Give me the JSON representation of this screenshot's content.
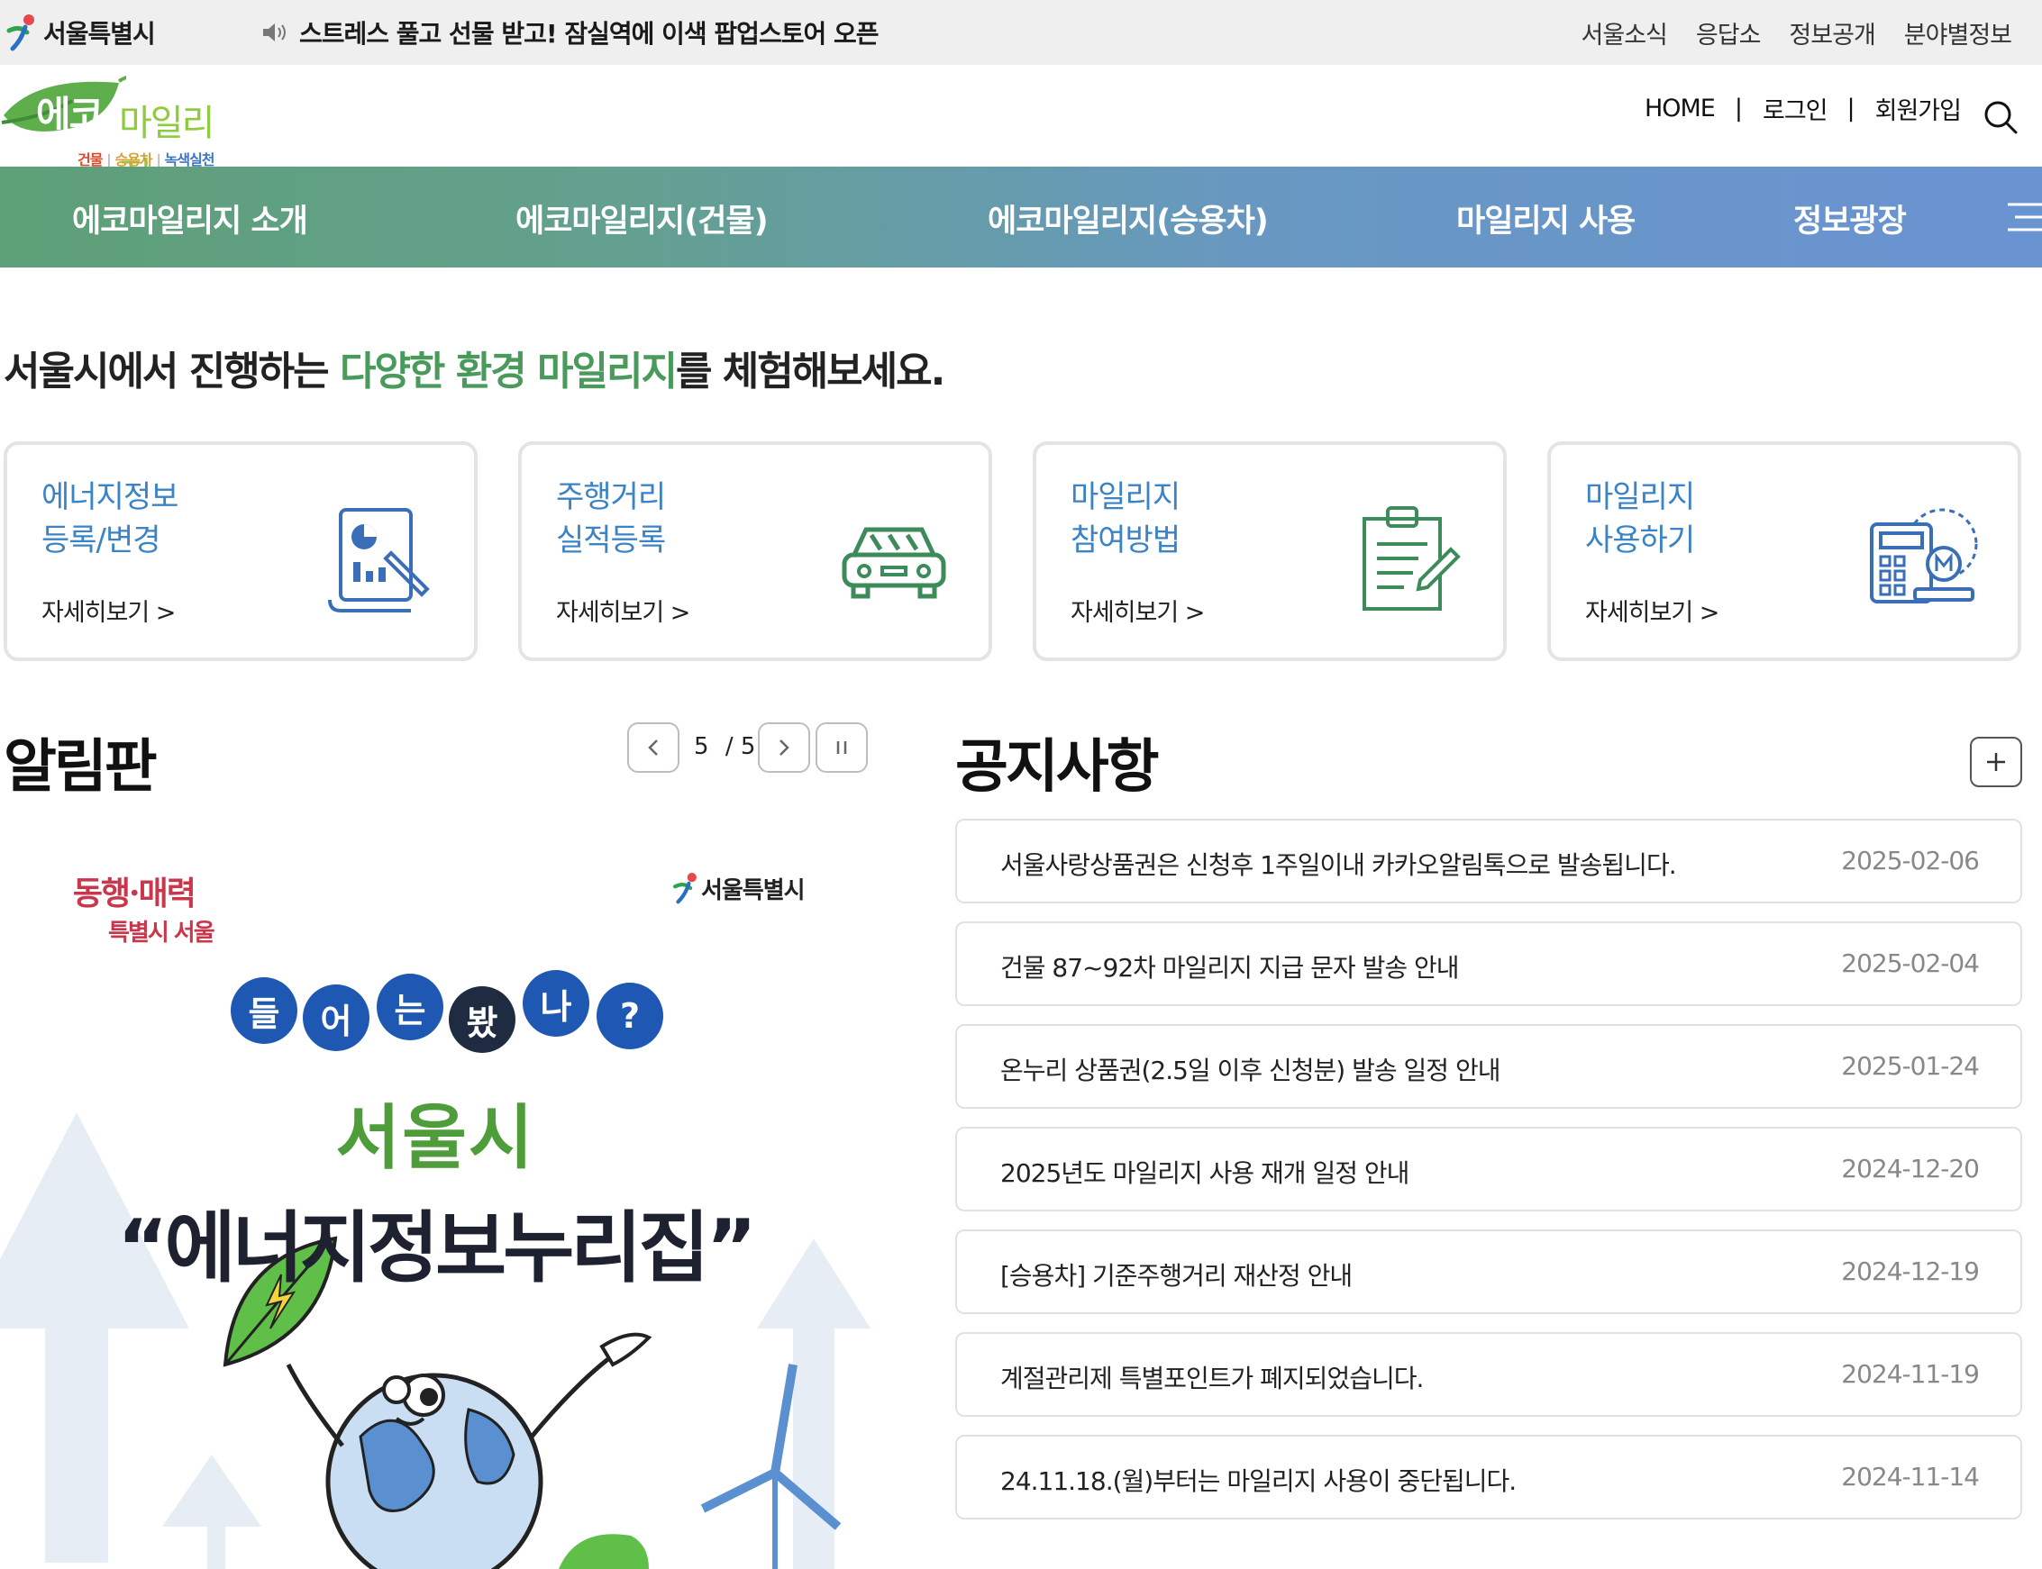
{
  "topbar": {
    "seoul_logo_text": "서울특별시",
    "news_text": "스트레스 풀고 선물 받고! 잠실역에 이색 팝업스토어 오픈",
    "links": [
      "서울소식",
      "응답소",
      "정보공개",
      "분야별정보"
    ]
  },
  "header": {
    "logo_eco": "에코",
    "logo_mileage": "마일리지",
    "logo_sub_a": "건물",
    "logo_sub_b": "승용차",
    "logo_sub_c": "녹색실천",
    "links": [
      "HOME",
      "로그인",
      "회원가입"
    ],
    "separator": "|"
  },
  "gnb": {
    "items": [
      "에코마일리지 소개",
      "에코마일리지(건물)",
      "에코마일리지(승용차)",
      "마일리지 사용",
      "정보광장"
    ]
  },
  "intro": {
    "prefix": "서울시에서 진행하는 ",
    "highlight": "다양한 환경 마일리지",
    "suffix": "를 체험해보세요."
  },
  "cards": [
    {
      "line1": "에너지정보",
      "line2": "등록/변경",
      "more": "자세히보기 >",
      "icon": "energy-report-icon"
    },
    {
      "line1": "주행거리",
      "line2": "실적등록",
      "more": "자세히보기 >",
      "icon": "car-icon"
    },
    {
      "line1": "마일리지",
      "line2": "참여방법",
      "more": "자세히보기 >",
      "icon": "clipboard-pen-icon"
    },
    {
      "line1": "마일리지",
      "line2": "사용하기",
      "more": "자세히보기 >",
      "icon": "calculator-mileage-icon"
    }
  ],
  "board": {
    "title": "알림판",
    "page_current": "5",
    "page_total": "/ 5",
    "poster": {
      "slogan_line1": "동행·매력",
      "slogan_line2": "특별시 서울",
      "seoul_logo": "서울특별시",
      "bubbles": [
        "들",
        "어",
        "는",
        "봤",
        "나",
        "?"
      ],
      "city": "서울시",
      "headline": "“에너지정보누리집”"
    }
  },
  "notice": {
    "title": "공지사항",
    "items": [
      {
        "title": "서울사랑상품권은 신청후 1주일이내 카카오알림톡으로 발송됩니다.",
        "date": "2025-02-06"
      },
      {
        "title": "건물 87~92차 마일리지 지급 문자 발송 안내",
        "date": "2025-02-04"
      },
      {
        "title": "온누리 상품권(2.5일 이후 신청분) 발송 일정 안내",
        "date": "2025-01-24"
      },
      {
        "title": "2025년도 마일리지 사용 재개 일정 안내",
        "date": "2024-12-20"
      },
      {
        "title": "[승용차] 기준주행거리 재산정 안내",
        "date": "2024-12-19"
      },
      {
        "title": "계절관리제 특별포인트가 폐지되었습니다.",
        "date": "2024-11-19"
      },
      {
        "title": "24.11.18.(월)부터는 마일리지 사용이 중단됩니다.",
        "date": "2024-11-14"
      }
    ]
  },
  "colors": {
    "gnb_start": "#5ea077",
    "gnb_end": "#6a93d2",
    "card_title": "#3a83c6",
    "intro_highlight": "#4a9a5c",
    "icon_green": "#3d8a5a",
    "icon_blue": "#3a6fb8"
  }
}
